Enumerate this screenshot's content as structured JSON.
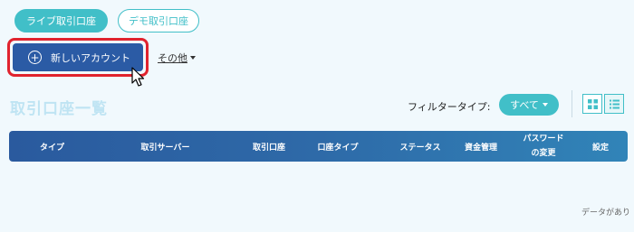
{
  "tabs": {
    "live": "ライブ取引口座",
    "demo": "デモ取引口座"
  },
  "actions": {
    "new_account": "新しいアカウント",
    "other": "その他"
  },
  "page": {
    "title": "取引口座一覧"
  },
  "filter": {
    "label": "フィルタータイプ:",
    "selected": "すべて"
  },
  "table": {
    "columns": {
      "type": "タイプ",
      "server": "取引サーバー",
      "account": "取引口座",
      "account_type": "口座タイプ",
      "status": "ステータス",
      "funds": "資金管理",
      "password_line1": "パスワード",
      "password_line2": "の変更",
      "settings": "設定"
    },
    "empty_message": "データがあり"
  },
  "colors": {
    "accent": "#41bfc8",
    "primary": "#2b5ba5",
    "highlight_border": "#e0232e",
    "background": "#f1f9fd"
  },
  "icons": {
    "new_account": "plus-circle-icon",
    "grid_view": "grid-icon",
    "list_view": "list-icon",
    "pointer": "mouse-cursor-icon"
  }
}
